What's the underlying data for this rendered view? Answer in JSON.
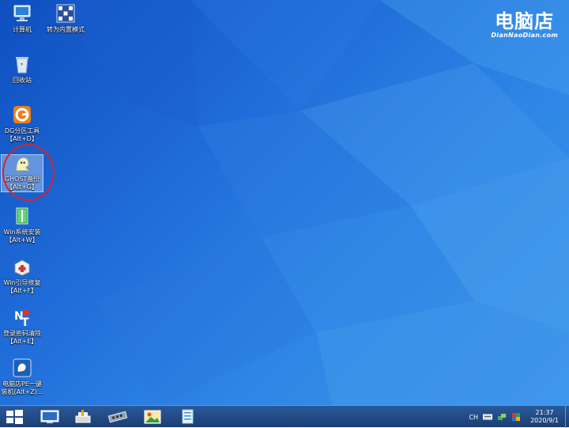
{
  "watermark": {
    "brand": "电脑店",
    "sub": "DianNaoDian.com"
  },
  "desktop_icons": [
    {
      "label": "计算机",
      "icon": "computer-icon"
    },
    {
      "label": "转为内置模式",
      "icon": "internal-mode-icon"
    },
    {
      "label": "回收站",
      "icon": "recycle-bin-icon"
    },
    {
      "label": "DG分区工具\n【Alt+D】",
      "icon": "diskgenius-icon"
    },
    {
      "label": "GHOST备份\n【Alt+G】",
      "icon": "ghost-icon",
      "selected": true
    },
    {
      "label": "Win系统安装\n【Alt+W】",
      "icon": "win-install-icon"
    },
    {
      "label": "Win引导修复\n【Alt+F】",
      "icon": "boot-repair-icon"
    },
    {
      "label": "登录密码清除\n【Alt+E】",
      "icon": "password-clear-icon"
    },
    {
      "label": "电脑店PE一键\n装机(Alt+Z)...",
      "icon": "pe-install-icon"
    }
  ],
  "taskbar": {
    "items": [
      "screen-monitor-icon",
      "printer-tools-icon",
      "memory-chip-icon",
      "photo-viewer-icon",
      "notepad-icon"
    ],
    "tray": {
      "ime": "CH",
      "time": "21:37",
      "date": "2020/9/1"
    }
  },
  "colors": {
    "annotation": "#d8242b",
    "taskbar": "#1f4a85"
  }
}
